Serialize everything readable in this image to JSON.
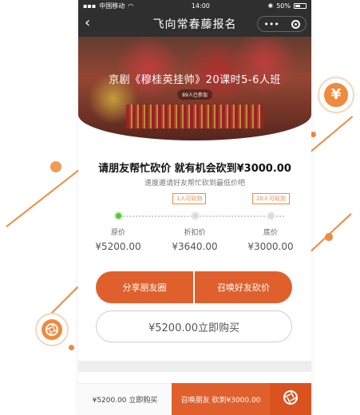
{
  "status_bar": {
    "carrier": "中国移动",
    "time": "14:00",
    "battery": "50%"
  },
  "nav": {
    "title": "飞向常春藤报名",
    "menu_dots": "•••"
  },
  "banner": {
    "title": "京剧《穆桂英挂帅》20课时5-6人班",
    "participants": "89人已参加"
  },
  "promo": {
    "headline": "请朋友帮忙砍价 就有机会砍到¥3000.00",
    "subline": "速度邀请好友帮忙砍到最低价吧"
  },
  "progress": {
    "tags": [
      "1人可砍到",
      "20人可砍到"
    ],
    "steps": [
      {
        "label": "原价",
        "value": "¥5200.00"
      },
      {
        "label": "折扣价",
        "value": "¥3640.00"
      },
      {
        "label": "底价",
        "value": "¥3000.00"
      }
    ]
  },
  "actions": {
    "share_moments": "分享朋友圈",
    "invite_friends": "召唤好友砍价",
    "buy_now": "¥5200.00立即购买"
  },
  "bottom_bar": {
    "buy": "¥5200.00 立即购买",
    "invite": "召唤朋友 砍到¥3000.00"
  },
  "colors": {
    "accent": "#e0602d",
    "dark_bar": "#2f2f2f",
    "active_step": "#5bc23a"
  },
  "decorations": {
    "badge_top_symbol": "¥"
  }
}
